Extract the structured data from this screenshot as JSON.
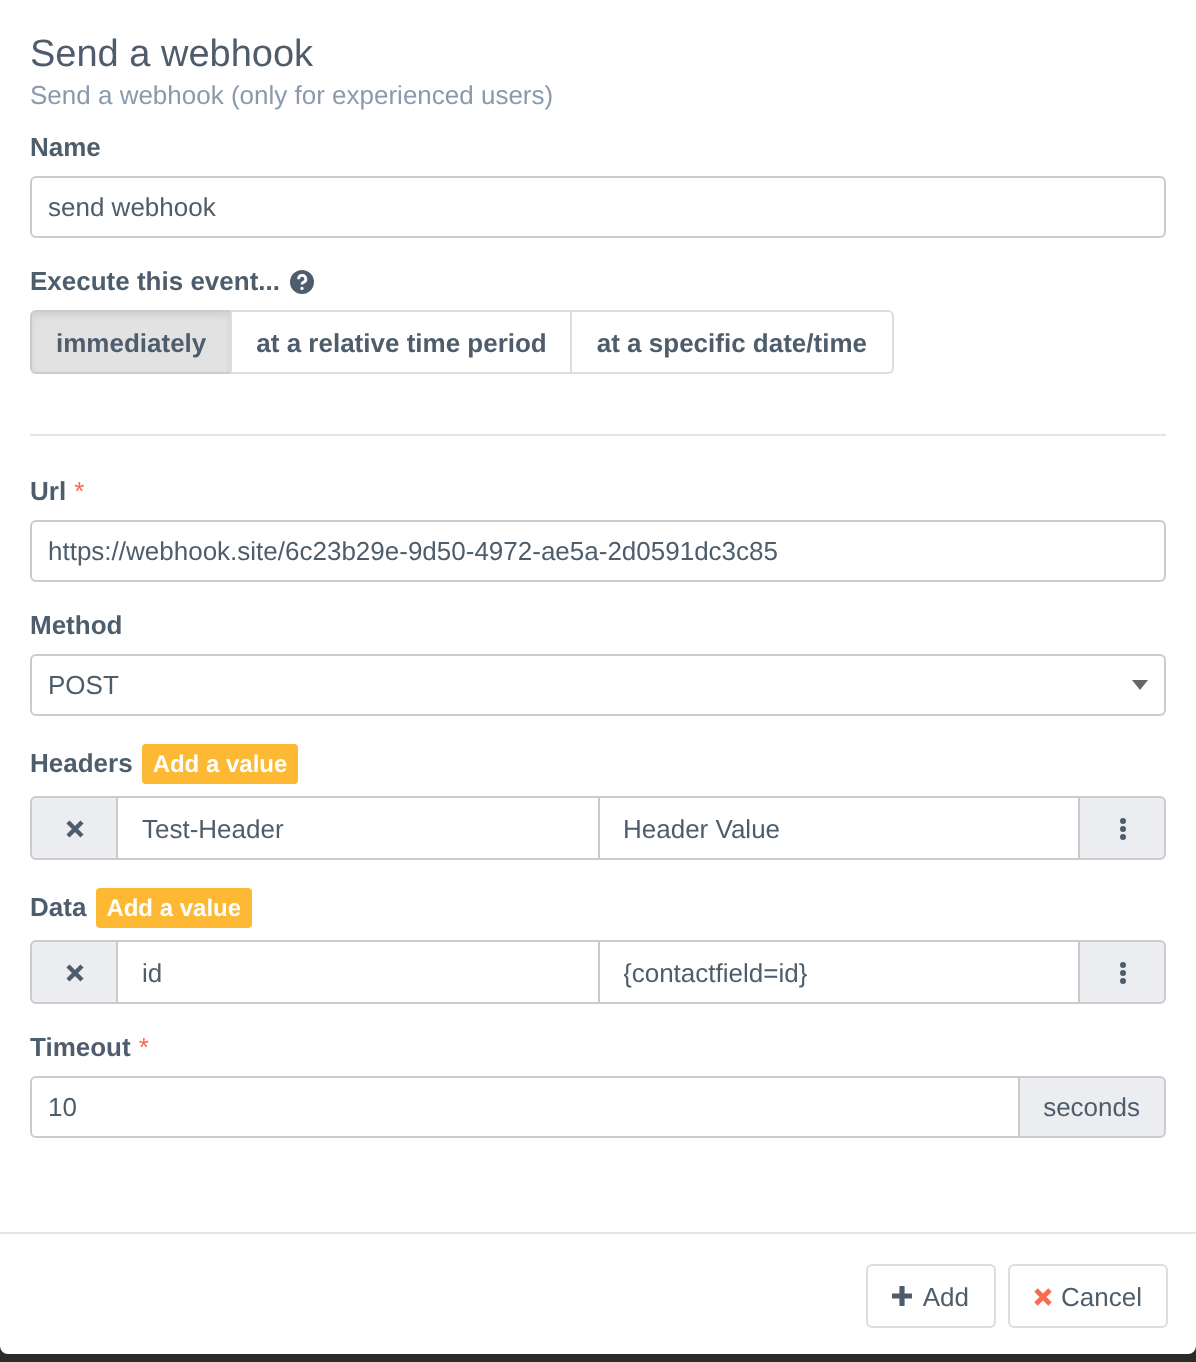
{
  "dialog": {
    "title": "Send a webhook",
    "subtitle": "Send a webhook (only for experienced users)"
  },
  "name_field": {
    "label": "Name",
    "value": "send webhook"
  },
  "execute": {
    "label": "Execute this event...",
    "options": [
      {
        "label": "immediately",
        "selected": true
      },
      {
        "label": "at a relative time period",
        "selected": false
      },
      {
        "label": "at a specific date/time",
        "selected": false
      }
    ]
  },
  "url_field": {
    "label": "Url",
    "required_mark": "*",
    "value": "https://webhook.site/6c23b29e-9d50-4972-ae5a-2d0591dc3c85"
  },
  "method_field": {
    "label": "Method",
    "value": "POST"
  },
  "lists": [
    {
      "label": "Headers",
      "add_label": "Add a value",
      "rows": [
        {
          "key": "Test-Header",
          "value": "Header Value"
        }
      ]
    },
    {
      "label": "Data",
      "add_label": "Add a value",
      "rows": [
        {
          "key": "id",
          "value": "{contactfield=id}"
        }
      ]
    }
  ],
  "timeout_field": {
    "label": "Timeout",
    "required_mark": "*",
    "value": "10",
    "addon": "seconds"
  },
  "buttons": [
    {
      "kind": "add",
      "label": "Add"
    },
    {
      "kind": "cancel",
      "label": "Cancel"
    }
  ]
}
